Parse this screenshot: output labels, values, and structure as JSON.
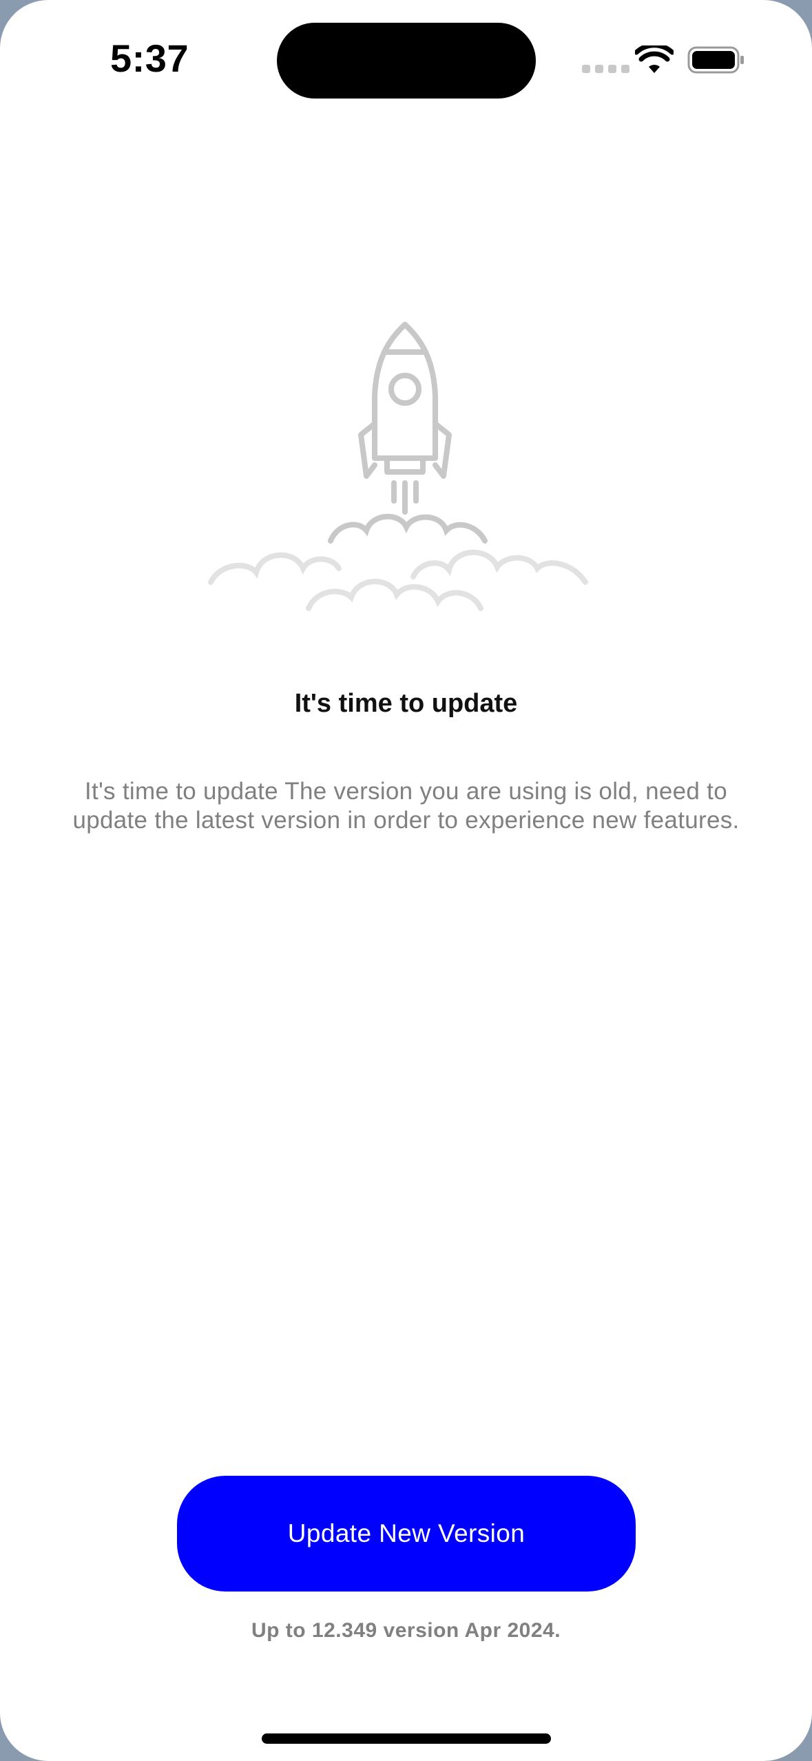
{
  "status_bar": {
    "time": "5:37"
  },
  "illustration": {
    "icon": "rocket-launch-icon"
  },
  "content": {
    "title": "It's time to update",
    "description": "It's time to update The version you are using is old, need to update the latest version in order to experience new features."
  },
  "actions": {
    "update_label": "Update New Version",
    "version_note": "Up to 12.349 version Apr 2024."
  },
  "colors": {
    "accent": "#0000ff",
    "muted_text": "#808080",
    "illustration": "#c8c8c8"
  }
}
